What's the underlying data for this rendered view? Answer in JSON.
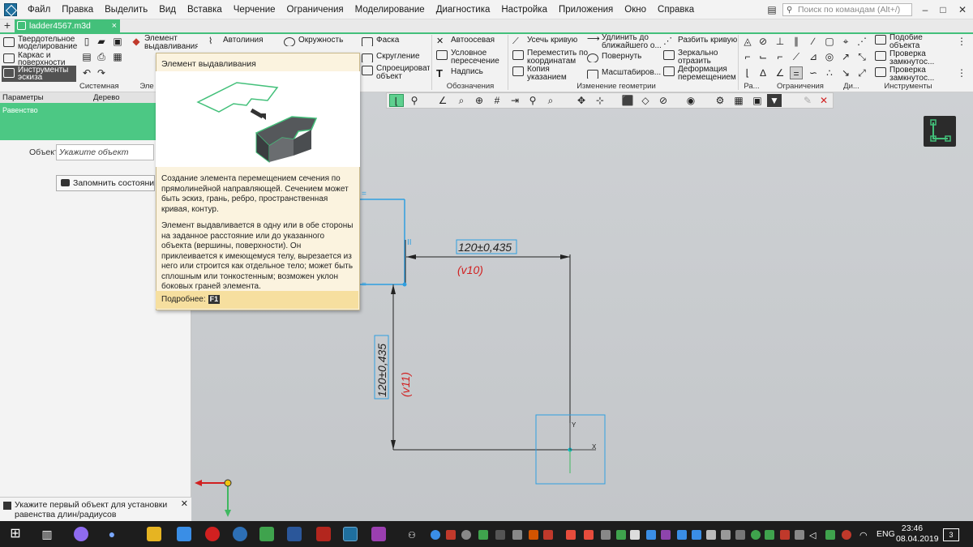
{
  "menubar": {
    "items": [
      "Файл",
      "Правка",
      "Выделить",
      "Вид",
      "Вставка",
      "Черчение",
      "Ограничения",
      "Моделирование",
      "Диагностика",
      "Настройка",
      "Приложения",
      "Окно",
      "Справка"
    ],
    "search_placeholder": "Поиск по командам (Alt+/)"
  },
  "tabs": {
    "active_document": "ladder4567.m3d",
    "plus": "+",
    "close": "×"
  },
  "ribbon": {
    "modes": [
      "Твердотельное моделирование",
      "Каркас и поверхности",
      "Инструменты эскиза"
    ],
    "buttons": {
      "extrude": "Элемент выдавливания",
      "autoline": "Автолиния",
      "circle": "Окружность",
      "chamfer": "Фаска",
      "fillet": "Скругление",
      "project": "Спроецировать объект",
      "axis": "Автоосевая",
      "cond_intersect": "Условное пересечение",
      "text_label": "Надпись",
      "trim": "Усечь кривую",
      "move_coords": "Переместить по координатам",
      "copy_ptr": "Копия указанием",
      "extend": "Удлинить до ближайшего о...",
      "rotate": "Повернуть",
      "scale": "Масштабиров...",
      "split": "Разбить кривую",
      "mirror": "Зеркально отразить",
      "deform": "Деформация перемещением",
      "subobj": "Подобие объекта",
      "check1": "Проверка замкнутос...",
      "check2": "Проверка замкнутос..."
    },
    "sections": {
      "system": "Системная",
      "el": "Эле",
      "designations": "Обозначения",
      "geom_edit": "Изменение геометрии",
      "ra": "Ра...",
      "constraints": "Ограничения",
      "di": "Ди...",
      "tools": "Инструменты"
    }
  },
  "left_panel": {
    "tab_params": "Параметры",
    "tab_tree": "Дерево",
    "operation": "Равенство",
    "object_label": "Объект:",
    "object_placeholder": "Укажите объект",
    "memo_button": "Запомнить состояние",
    "status_text": "Укажите первый объект для установки равенства длин/радиусов"
  },
  "tooltip": {
    "title": "Элемент выдавливания",
    "p1": "Создание элемента перемещением сечения по прямолинейной направляющей. Сечением может быть эскиз, грань, ребро, пространственная кривая, контур.",
    "p2": "Элемент выдавливается в одну или в обе стороны на заданное расстояние или до указанного объекта (вершины, поверхности). Он приклеивается к имеющемуся телу, вырезается из него или строится как отдельное тело; может быть сплошным или тонкостенным; возможен уклон боковых граней элемента.",
    "more_label": "Подробнее:",
    "key": "F1"
  },
  "drawing": {
    "dim_horizontal": "120±0,435",
    "var_horizontal": "(v10)",
    "dim_vertical": "120±0,435",
    "var_vertical": "(v11)",
    "axis_x": "X",
    "axis_y": "Y",
    "parallel_mark": "II",
    "equal_mark": "="
  },
  "taskbar": {
    "lang": "ENG",
    "time": "23:46",
    "date": "08.04.2019",
    "badge": "3"
  },
  "colors": {
    "accent": "#43c07a",
    "dim_text": "#d12020",
    "sketch": "#2f9fe0"
  }
}
